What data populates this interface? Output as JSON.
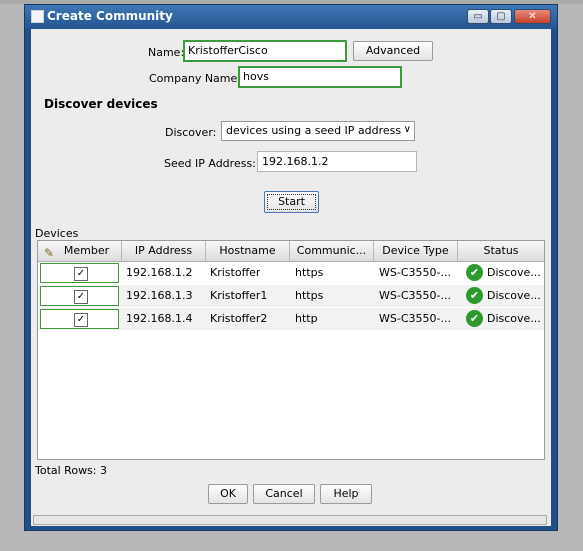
{
  "window": {
    "title": "Create Community"
  },
  "form": {
    "name_label": "Name:",
    "name_value": "KristofferCisco",
    "advanced_label": "Advanced",
    "company_label": "Company Name:",
    "company_value": "hovs"
  },
  "discover": {
    "section_title": "Discover devices",
    "discover_label": "Discover:",
    "discover_value": "devices using a seed IP address",
    "seed_label": "Seed IP Address:",
    "seed_value": "192.168.1.2",
    "start_label": "Start"
  },
  "devices": {
    "section_label": "Devices",
    "columns": [
      "Member",
      "IP Address",
      "Hostname",
      "Communic...",
      "Device Type",
      "Status"
    ],
    "rows": [
      {
        "ip": "192.168.1.2",
        "hostname": "Kristoffer",
        "community": "https",
        "device_type": "WS-C3550-...",
        "status": "Discove..."
      },
      {
        "ip": "192.168.1.3",
        "hostname": "Kristoffer1",
        "community": "https",
        "device_type": "WS-C3550-...",
        "status": "Discove..."
      },
      {
        "ip": "192.168.1.4",
        "hostname": "Kristoffer2",
        "community": "http",
        "device_type": "WS-C3550-...",
        "status": "Discove..."
      }
    ],
    "total_rows": "Total Rows: 3"
  },
  "footer": {
    "ok_label": "OK",
    "cancel_label": "Cancel",
    "help_label": "Help"
  },
  "icons": {
    "checkmark": "✓",
    "status_ok": "✔"
  }
}
